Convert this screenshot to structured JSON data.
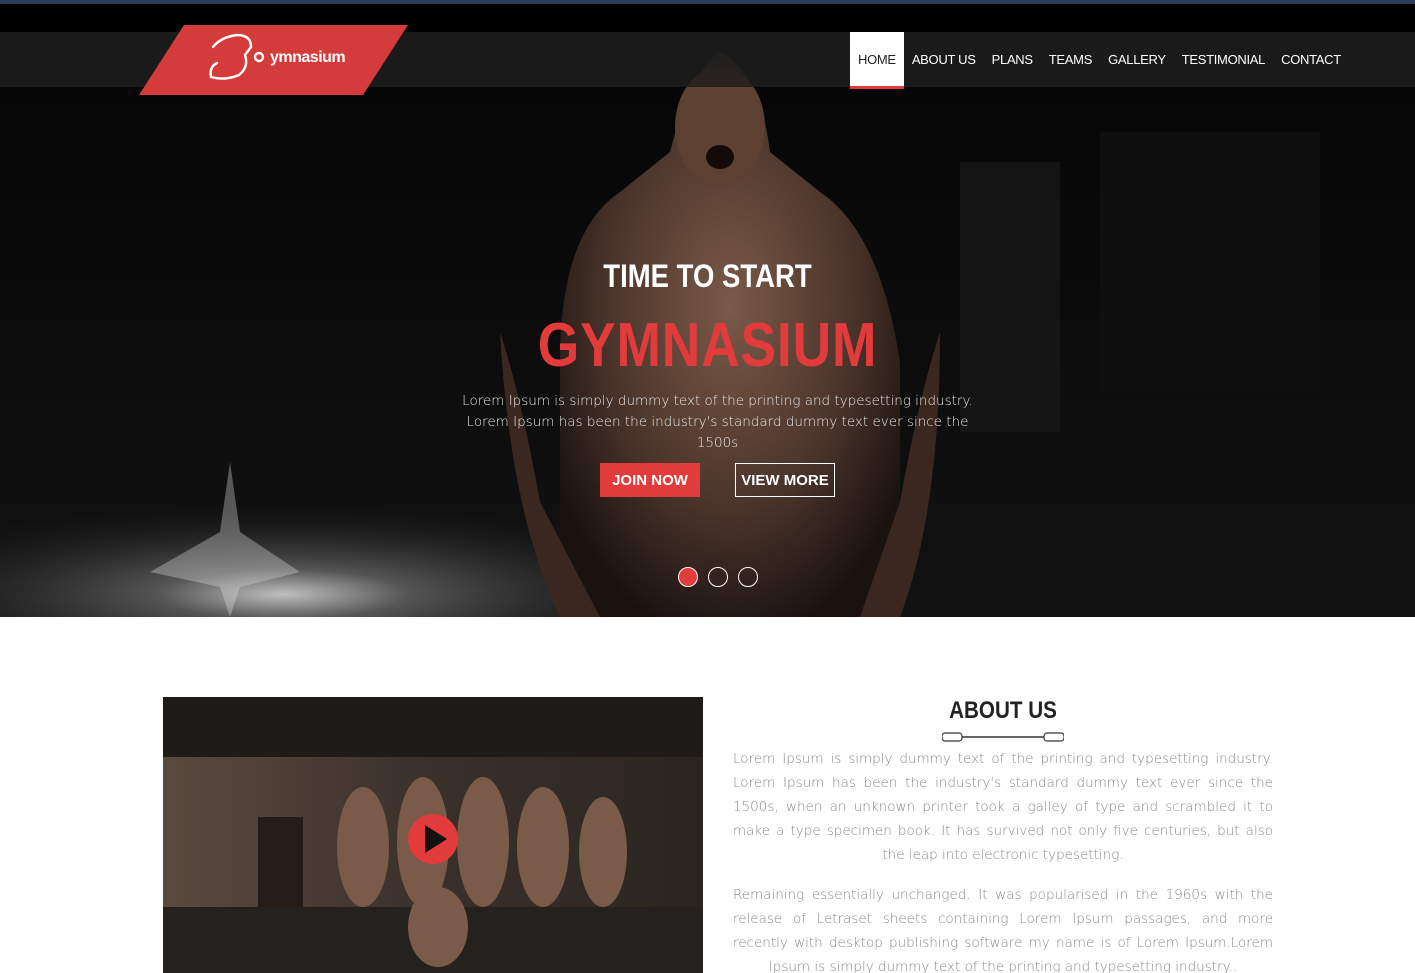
{
  "brand": {
    "logo_text": "ymnasium"
  },
  "nav": {
    "items": [
      {
        "label": "HOME",
        "active": true
      },
      {
        "label": "ABOUT US"
      },
      {
        "label": "PLANS"
      },
      {
        "label": "TEAMS"
      },
      {
        "label": "GALLERY"
      },
      {
        "label": "TESTIMONIAL"
      },
      {
        "label": "CONTACT"
      }
    ]
  },
  "hero": {
    "subtitle": "TIME TO START",
    "title": "GYMNASIUM",
    "description": "Lorem Ipsum is simply dummy text of the printing and typesetting industry. Lorem Ipsum has been the industry's standard dummy text ever since the 1500s",
    "join_label": "JOIN NOW",
    "view_label": "VIEW MORE",
    "slides": 3,
    "active_slide": 1
  },
  "about": {
    "title": "ABOUT US",
    "paragraph1": "Lorem Ipsum is simply dummy text of the printing and typesetting industry. Lorem Ipsum has been the industry's standard dummy text ever since the 1500s, when an unknown printer took a galley of type and scrambled it to make a type specimen book. It has survived not only five centuries, but also the leap into electronic typesetting.",
    "paragraph2": "Remaining essentially unchanged. It was popularised in the 1960s with the release of Letraset sheets containing Lorem Ipsum passages, and more recently with desktop publishing software my name is of Lorem Ipsum.Lorem Ipsum is simply dummy text of the printing and typesetting industry.."
  },
  "colors": {
    "accent": "#e23b3b",
    "dark": "#070707",
    "topline": "#2b3d5c"
  }
}
